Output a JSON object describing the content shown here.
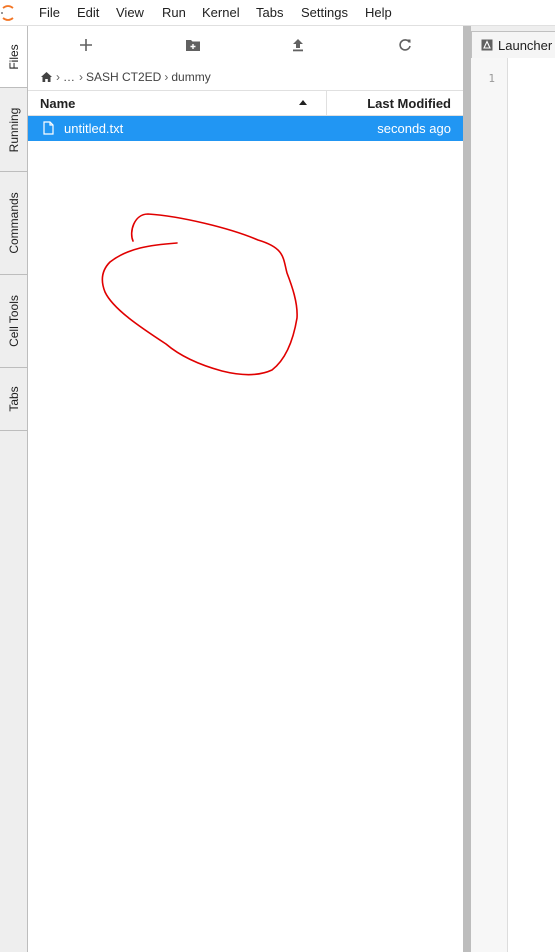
{
  "menu": {
    "items": [
      "File",
      "Edit",
      "View",
      "Run",
      "Kernel",
      "Tabs",
      "Settings",
      "Help"
    ]
  },
  "side_tabs": [
    "Files",
    "Running",
    "Commands",
    "Cell Tools",
    "Tabs"
  ],
  "file_browser": {
    "toolbar_icons": [
      "new-launcher-icon",
      "new-folder-icon",
      "upload-icon",
      "refresh-icon"
    ],
    "breadcrumbs": {
      "ellipsis": "…",
      "path": [
        "SASH CT2ED",
        "dummy"
      ]
    },
    "columns": {
      "name": "Name",
      "modified": "Last Modified"
    },
    "files": [
      {
        "name": "untitled.txt",
        "modified": "seconds ago",
        "selected": true
      }
    ]
  },
  "dock": {
    "tab_label": "Launcher",
    "line_number": "1"
  },
  "colors": {
    "accent": "#2196f3",
    "annotation": "#e00000",
    "logo": "#f37626"
  }
}
